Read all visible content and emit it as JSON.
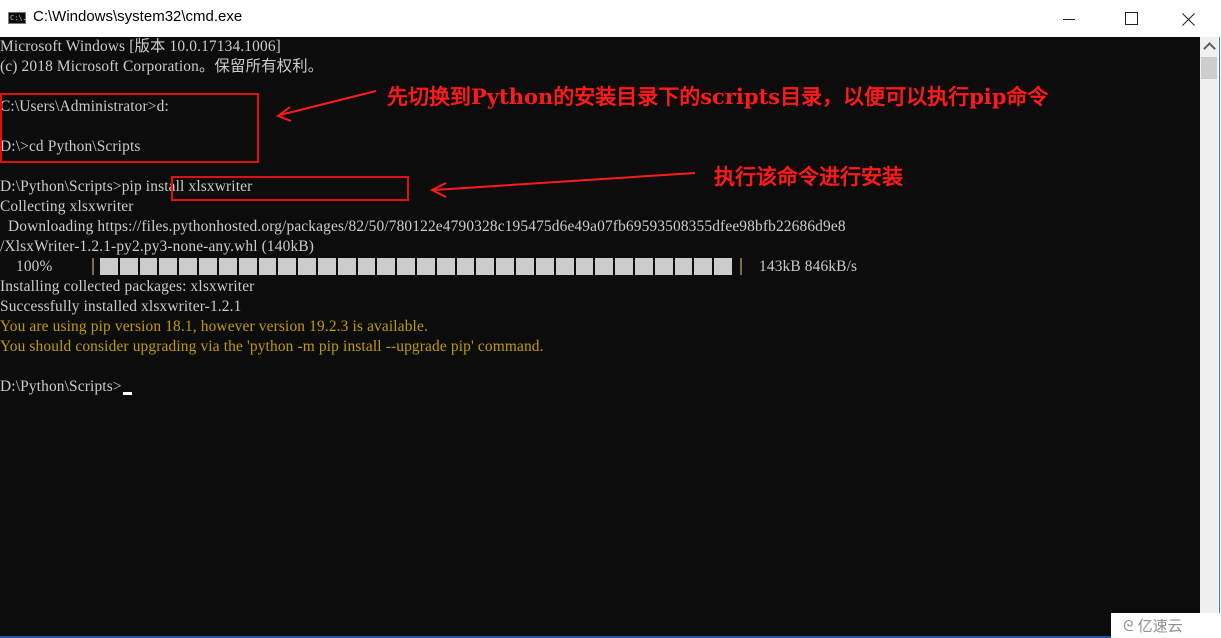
{
  "window": {
    "title": "C:\\Windows\\system32\\cmd.exe",
    "icon": "cmd-icon",
    "icon_text": "C:\\.",
    "controls": [
      "minimize",
      "maximize",
      "close"
    ]
  },
  "console": {
    "lines": [
      {
        "text": "Microsoft Windows [版本 10.0.17134.1006]",
        "style": "normal"
      },
      {
        "text": "(c) 2018 Microsoft Corporation。保留所有权利。",
        "style": "normal"
      },
      {
        "text": "",
        "style": "normal"
      },
      {
        "text": "C:\\Users\\Administrator>d:",
        "style": "normal"
      },
      {
        "text": "",
        "style": "normal"
      },
      {
        "text": "D:\\>cd Python\\Scripts",
        "style": "normal"
      },
      {
        "text": "",
        "style": "normal"
      },
      {
        "text": "D:\\Python\\Scripts>pip install xlsxwriter",
        "style": "normal"
      },
      {
        "text": "Collecting xlsxwriter",
        "style": "normal"
      },
      {
        "text": "  Downloading https://files.pythonhosted.org/packages/82/50/780122e4790328c195475d6e49a07fb69593508355dfee98bfb22686d9e8",
        "style": "normal"
      },
      {
        "text": "/XlsxWriter-1.2.1-py2.py3-none-any.whl (140kB)",
        "style": "normal"
      },
      {
        "text": "",
        "style": "progress"
      },
      {
        "text": "Installing collected packages: xlsxwriter",
        "style": "normal"
      },
      {
        "text": "Successfully installed xlsxwriter-1.2.1",
        "style": "normal"
      },
      {
        "text": "You are using pip version 18.1, however version 19.2.3 is available.",
        "style": "yellow"
      },
      {
        "text": "You should consider upgrading via the 'python -m pip install --upgrade pip' command.",
        "style": "yellow"
      },
      {
        "text": "",
        "style": "normal"
      },
      {
        "text": "D:\\Python\\Scripts>",
        "style": "prompt"
      }
    ],
    "progress": {
      "percent_label": "    100%",
      "fraction": 1.0,
      "stats": "143kB 846kB/s"
    },
    "colors": {
      "background": "#0c0c0c",
      "text": "#cccccc",
      "warning": "#c19c00",
      "annotation": "#ff1a1a"
    }
  },
  "annotations": [
    {
      "text": "先切换到Python的安装目录下的scripts目录，以便可以执行pip命令",
      "target": "cd commands box"
    },
    {
      "text": "执行该命令进行安装",
      "target": "pip install command box"
    }
  ],
  "watermark": {
    "logo": "cloud-logo-icon",
    "text": "亿速云"
  }
}
